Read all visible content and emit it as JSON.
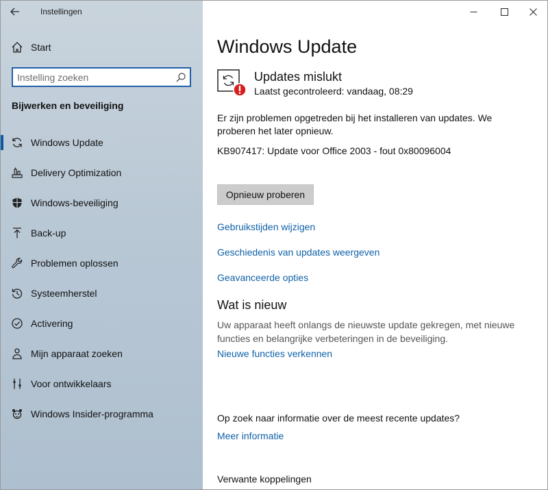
{
  "window": {
    "app_title": "Instellingen"
  },
  "sidebar": {
    "home_label": "Start",
    "search_placeholder": "Instelling zoeken",
    "section_title": "Bijwerken en beveiliging",
    "items": [
      {
        "label": "Windows Update",
        "icon": "refresh-icon",
        "selected": true
      },
      {
        "label": "Delivery Optimization",
        "icon": "delivery-icon",
        "selected": false
      },
      {
        "label": "Windows-beveiliging",
        "icon": "shield-icon",
        "selected": false
      },
      {
        "label": "Back-up",
        "icon": "upload-arrow-icon",
        "selected": false
      },
      {
        "label": "Problemen oplossen",
        "icon": "wrench-icon",
        "selected": false
      },
      {
        "label": "Systeemherstel",
        "icon": "history-icon",
        "selected": false
      },
      {
        "label": "Activering",
        "icon": "check-circle-icon",
        "selected": false
      },
      {
        "label": "Mijn apparaat zoeken",
        "icon": "person-pin-icon",
        "selected": false
      },
      {
        "label": "Voor ontwikkelaars",
        "icon": "tools-icon",
        "selected": false
      },
      {
        "label": "Windows Insider-programma",
        "icon": "insider-icon",
        "selected": false
      }
    ]
  },
  "main": {
    "title": "Windows Update",
    "status": {
      "title": "Updates mislukt",
      "subtitle": "Laatst gecontroleerd: vandaag, 08:29"
    },
    "message": "Er zijn problemen opgetreden bij het installeren van updates. We proberen het later opnieuw.",
    "kb_line": "KB907417: Update voor Office 2003 - fout 0x80096004",
    "retry_label": "Opnieuw proberen",
    "links": {
      "active_hours": "Gebruikstijden wijzigen",
      "history": "Geschiedenis van updates weergeven",
      "advanced": "Geavanceerde opties"
    },
    "whats_new": {
      "heading": "Wat is nieuw",
      "description": "Uw apparaat heeft onlangs de nieuwste update gekregen, met nieuwe functies en belangrijke verbeteringen in de beveiliging.",
      "link": "Nieuwe functies verkennen"
    },
    "info": {
      "question": "Op zoek naar informatie over de meest recente updates?",
      "link": "Meer informatie"
    },
    "related": "Verwante koppelingen"
  },
  "colors": {
    "accent": "#0a5aa8",
    "link": "#1061a8",
    "error": "#d81e1e",
    "button_bg": "#cccccc"
  }
}
